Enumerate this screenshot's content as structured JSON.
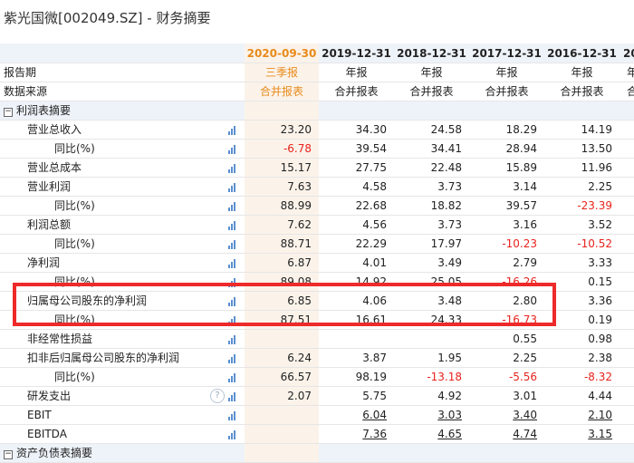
{
  "title": "紫光国微[002049.SZ] - 财务摘要",
  "periods": [
    "2020-09-30",
    "2019-12-31",
    "2018-12-31",
    "2017-12-31",
    "2016-12-31",
    "20"
  ],
  "report_period_label": "报告期",
  "report_types": [
    "三季报",
    "年报",
    "年报",
    "年报",
    "年报",
    "年"
  ],
  "data_source_label": "数据来源",
  "data_sources": [
    "合并报表",
    "合并报表",
    "合并报表",
    "合并报表",
    "合并报表",
    "合"
  ],
  "sections": {
    "income": "利润表摘要",
    "balance": "资产负债表摘要"
  },
  "rows": [
    {
      "label": "营业总收入",
      "values": [
        "23.20",
        "34.30",
        "24.58",
        "18.29",
        "14.19"
      ]
    },
    {
      "label": "同比(%)",
      "values": [
        "-6.78",
        "39.54",
        "34.41",
        "28.94",
        "13.50"
      ]
    },
    {
      "label": "营业总成本",
      "values": [
        "15.17",
        "27.75",
        "22.48",
        "15.89",
        "11.96"
      ]
    },
    {
      "label": "营业利润",
      "values": [
        "7.63",
        "4.58",
        "3.73",
        "3.14",
        "2.25"
      ]
    },
    {
      "label": "同比(%)",
      "values": [
        "88.99",
        "22.68",
        "18.82",
        "39.57",
        "-23.39"
      ]
    },
    {
      "label": "利润总额",
      "values": [
        "7.62",
        "4.56",
        "3.73",
        "3.16",
        "3.52"
      ]
    },
    {
      "label": "同比(%)",
      "values": [
        "88.71",
        "22.29",
        "17.97",
        "-10.23",
        "-10.52"
      ]
    },
    {
      "label": "净利润",
      "values": [
        "6.87",
        "4.01",
        "3.49",
        "2.79",
        "3.33"
      ]
    },
    {
      "label": "同比(%)",
      "values": [
        "89.08",
        "14.92",
        "25.05",
        "-16.26",
        "0.15"
      ]
    },
    {
      "label": "归属母公司股东的净利润",
      "values": [
        "6.85",
        "4.06",
        "3.48",
        "2.80",
        "3.36"
      ]
    },
    {
      "label": "同比(%)",
      "values": [
        "87.51",
        "16.61",
        "24.33",
        "-16.73",
        "0.19"
      ]
    },
    {
      "label": "非经常性损益",
      "values": [
        "",
        "",
        "",
        "0.55",
        "0.98"
      ]
    },
    {
      "label": "扣非后归属母公司股东的净利润",
      "values": [
        "6.24",
        "3.87",
        "1.95",
        "2.25",
        "2.38"
      ]
    },
    {
      "label": "同比(%)",
      "values": [
        "66.57",
        "98.19",
        "-13.18",
        "-5.56",
        "-8.32"
      ]
    },
    {
      "label": "研发支出",
      "values": [
        "2.07",
        "5.75",
        "4.92",
        "3.01",
        "4.44"
      ]
    },
    {
      "label": "EBIT",
      "values": [
        "",
        "6.04",
        "3.03",
        "3.40",
        "2.10"
      ]
    },
    {
      "label": "EBITDA",
      "values": [
        "",
        "7.36",
        "4.65",
        "4.74",
        "3.15"
      ]
    }
  ],
  "colors": {
    "accent": "#e88a1a",
    "negative": "#e8231d",
    "highlight": "#ee2a2a",
    "header_bg": "#eef3f9"
  },
  "icons": {
    "row_chart": "bar-chart-icon",
    "help": "help-icon"
  }
}
